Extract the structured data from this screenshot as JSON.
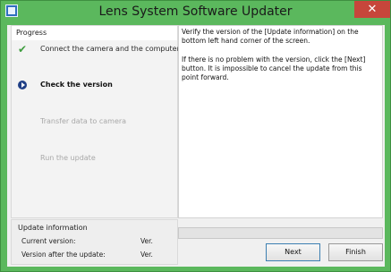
{
  "window": {
    "title": "Lens System Software Updater",
    "close_glyph": "✕"
  },
  "progress": {
    "heading": "Progress",
    "steps": [
      {
        "label": "Connect the camera and the computer",
        "state": "done",
        "icon": "check-icon"
      },
      {
        "label": "Check the version",
        "state": "current",
        "icon": "arrow-circle-icon"
      },
      {
        "label": "Transfer data to camera",
        "state": "pending"
      },
      {
        "label": "Run the update",
        "state": "pending"
      }
    ]
  },
  "description": {
    "paragraphs": [
      "Verify the version of the [Update information] on the bottom left hand corner of the screen.",
      "If there is no problem with the version, click the [Next] button. It is impossible to cancel the update from this point forward."
    ]
  },
  "update_info": {
    "heading": "Update information",
    "current_label": "Current version:",
    "current_value": "Ver.",
    "after_label": "Version after the update:",
    "after_value": "Ver."
  },
  "progress_bar": {
    "value": 0
  },
  "buttons": {
    "next": "Next",
    "finish": "Finish"
  }
}
